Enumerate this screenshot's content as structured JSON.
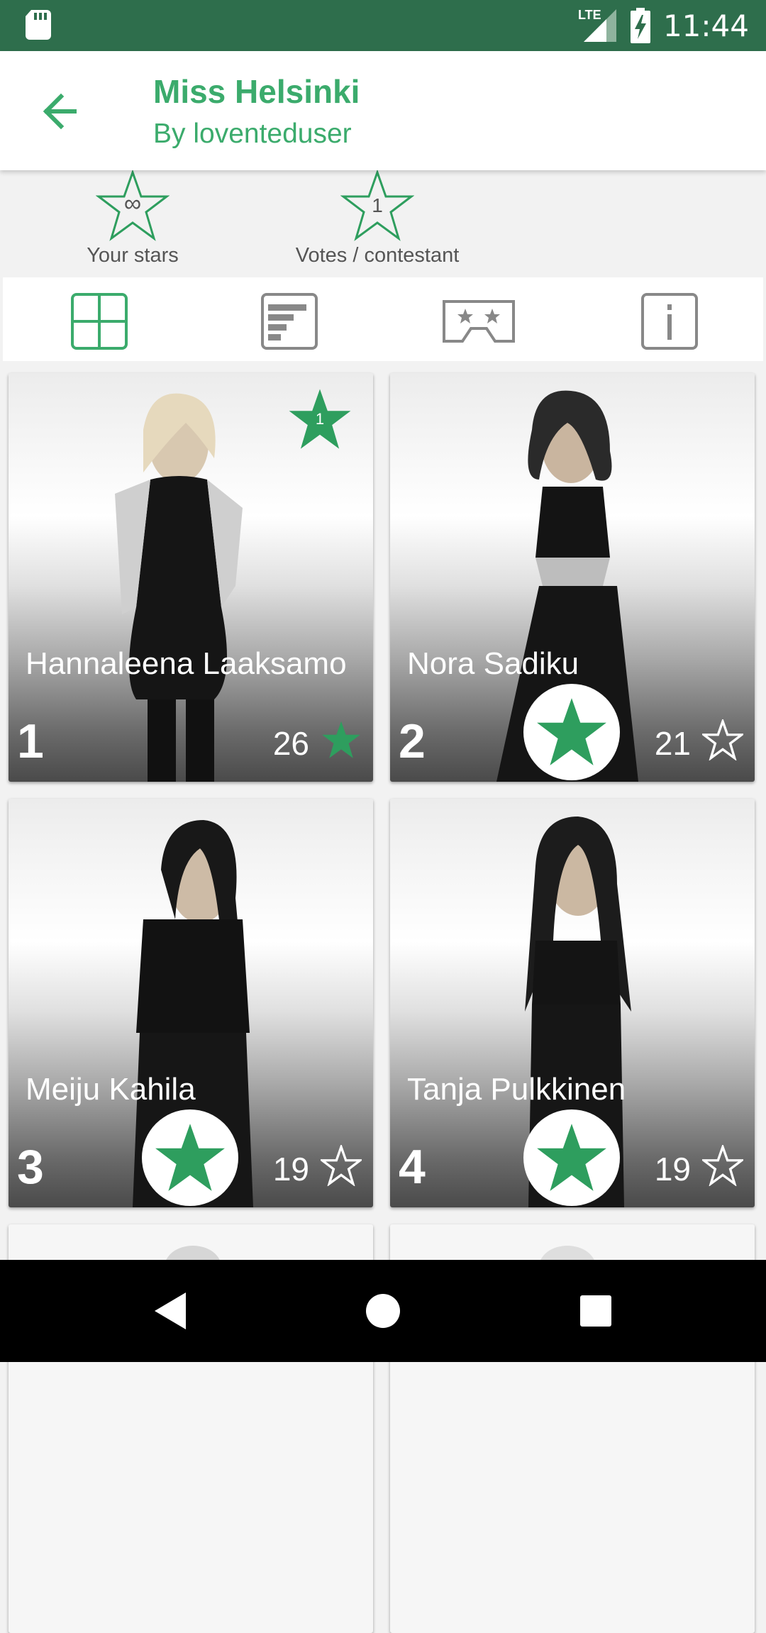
{
  "status_bar": {
    "network": "LTE",
    "time": "11:44"
  },
  "app_bar": {
    "title": "Miss Helsinki",
    "subtitle": "By loventeduser"
  },
  "stats": [
    {
      "value": "∞",
      "label": "Your stars"
    },
    {
      "value": "1",
      "label": "Votes / contestant"
    }
  ],
  "tabs": [
    {
      "icon": "grid-icon",
      "selected": true
    },
    {
      "icon": "leaderboard-icon",
      "selected": false
    },
    {
      "icon": "stage-icon",
      "selected": false
    },
    {
      "icon": "info-icon",
      "selected": false
    }
  ],
  "contestants": [
    {
      "rank": "1",
      "name": "Hannaleena Laaksamo",
      "votes": "26",
      "voted": true,
      "badge": "1"
    },
    {
      "rank": "2",
      "name": "Nora Sadiku",
      "votes": "21",
      "voted": false
    },
    {
      "rank": "3",
      "name": "Meiju Kahila",
      "votes": "19",
      "voted": false
    },
    {
      "rank": "4",
      "name": "Tanja Pulkkinen",
      "votes": "19",
      "voted": false
    }
  ],
  "colors": {
    "accent": "#3bab6c",
    "star_fill": "#2e9e5e",
    "status_bar": "#2e6e4c"
  }
}
